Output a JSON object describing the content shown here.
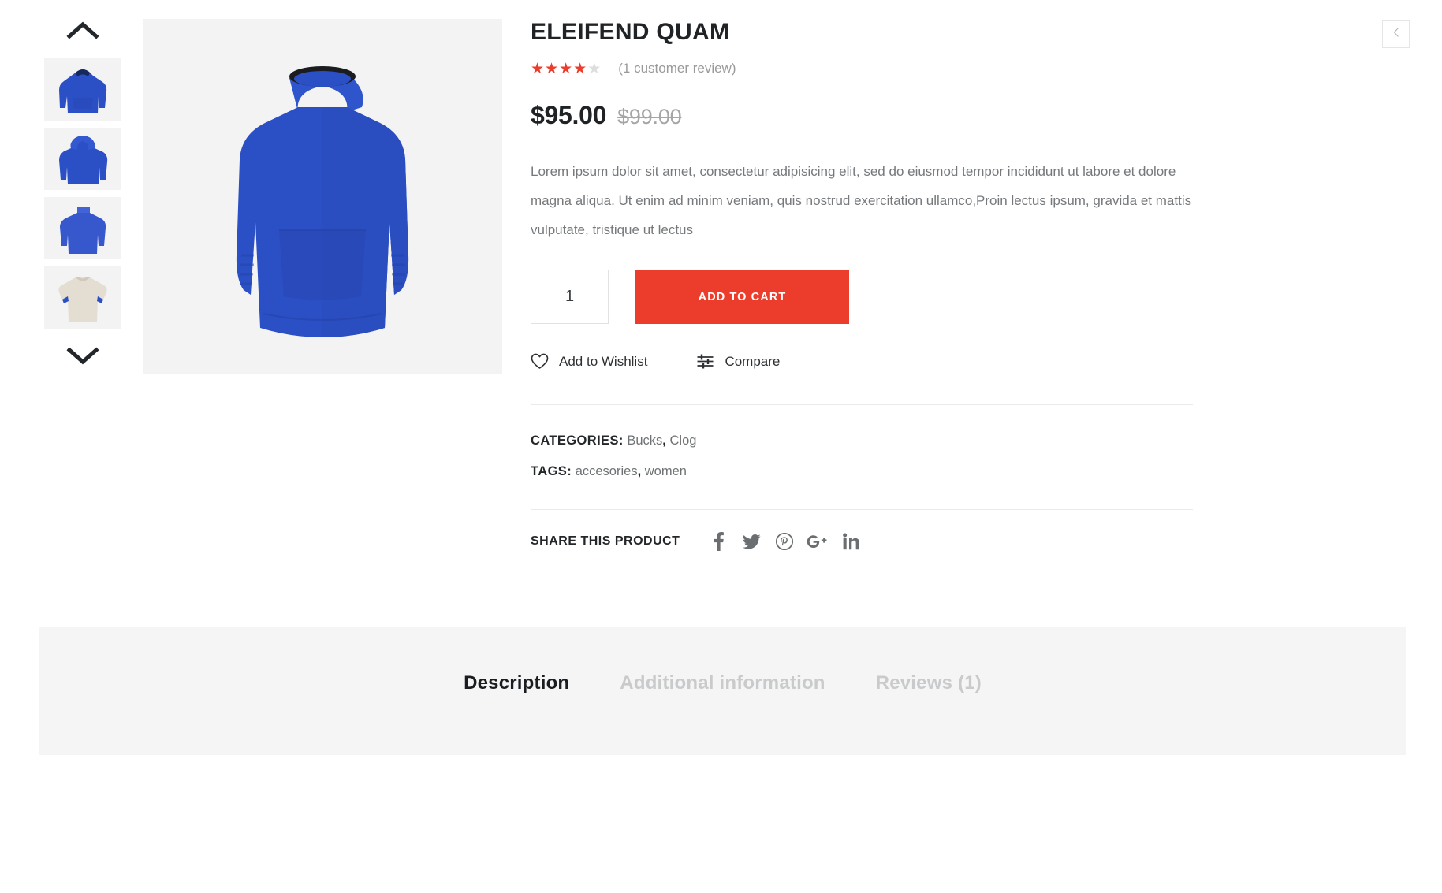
{
  "gallery": {
    "prev_arrow_icon": "chevron-up-icon",
    "next_arrow_icon": "chevron-down-icon",
    "thumbnails": [
      {
        "alt": "Blue hoodie front view",
        "variant": "hoodie-front",
        "color": "#2b4fc4"
      },
      {
        "alt": "Blue hoodie back view",
        "variant": "hoodie-back",
        "color": "#2b4fc4"
      },
      {
        "alt": "Blue long sleeve top",
        "variant": "longsleeve",
        "color": "#3758cc"
      },
      {
        "alt": "Cream t-shirt",
        "variant": "tshirt-cream",
        "color": "#e3ddd2"
      }
    ],
    "main_image_alt": "Royal blue pullover hoodie with kangaroo pocket"
  },
  "product": {
    "title": "ELEIFEND QUAM",
    "rating": 4,
    "rating_max": 5,
    "review_count_label": "(1 customer review)",
    "price_current": "$95.00",
    "price_original": "$99.00",
    "description": "Lorem ipsum dolor sit amet, consectetur adipisicing elit, sed do eiusmod tempor incididunt ut labore et dolore magna aliqua. Ut enim ad minim veniam, quis nostrud exercitation ullamco,Proin lectus ipsum, gravida et mattis vulputate, tristique ut lectus"
  },
  "cart": {
    "quantity": "1",
    "add_to_cart_label": "ADD TO CART",
    "accent_color": "#ec3c2c"
  },
  "actions": {
    "wishlist_label": "Add to Wishlist",
    "wishlist_icon": "heart-icon",
    "compare_label": "Compare",
    "compare_icon": "sliders-icon"
  },
  "meta": {
    "categories_label": "CATEGORIES:",
    "categories": [
      "Bucks",
      "Clog"
    ],
    "tags_label": "TAGS:",
    "tags": [
      "accesories",
      "women"
    ]
  },
  "share": {
    "label": "SHARE THIS PRODUCT",
    "networks": [
      {
        "name": "facebook",
        "icon": "facebook-icon"
      },
      {
        "name": "twitter",
        "icon": "twitter-icon"
      },
      {
        "name": "pinterest",
        "icon": "pinterest-icon"
      },
      {
        "name": "googleplus",
        "icon": "google-plus-icon"
      },
      {
        "name": "linkedin",
        "icon": "linkedin-icon"
      }
    ]
  },
  "nav": {
    "prev_icon": "chevron-left-icon"
  },
  "tabs": [
    {
      "label": "Description",
      "active": true
    },
    {
      "label": "Additional information",
      "active": false
    },
    {
      "label": "Reviews (1)",
      "active": false
    }
  ]
}
